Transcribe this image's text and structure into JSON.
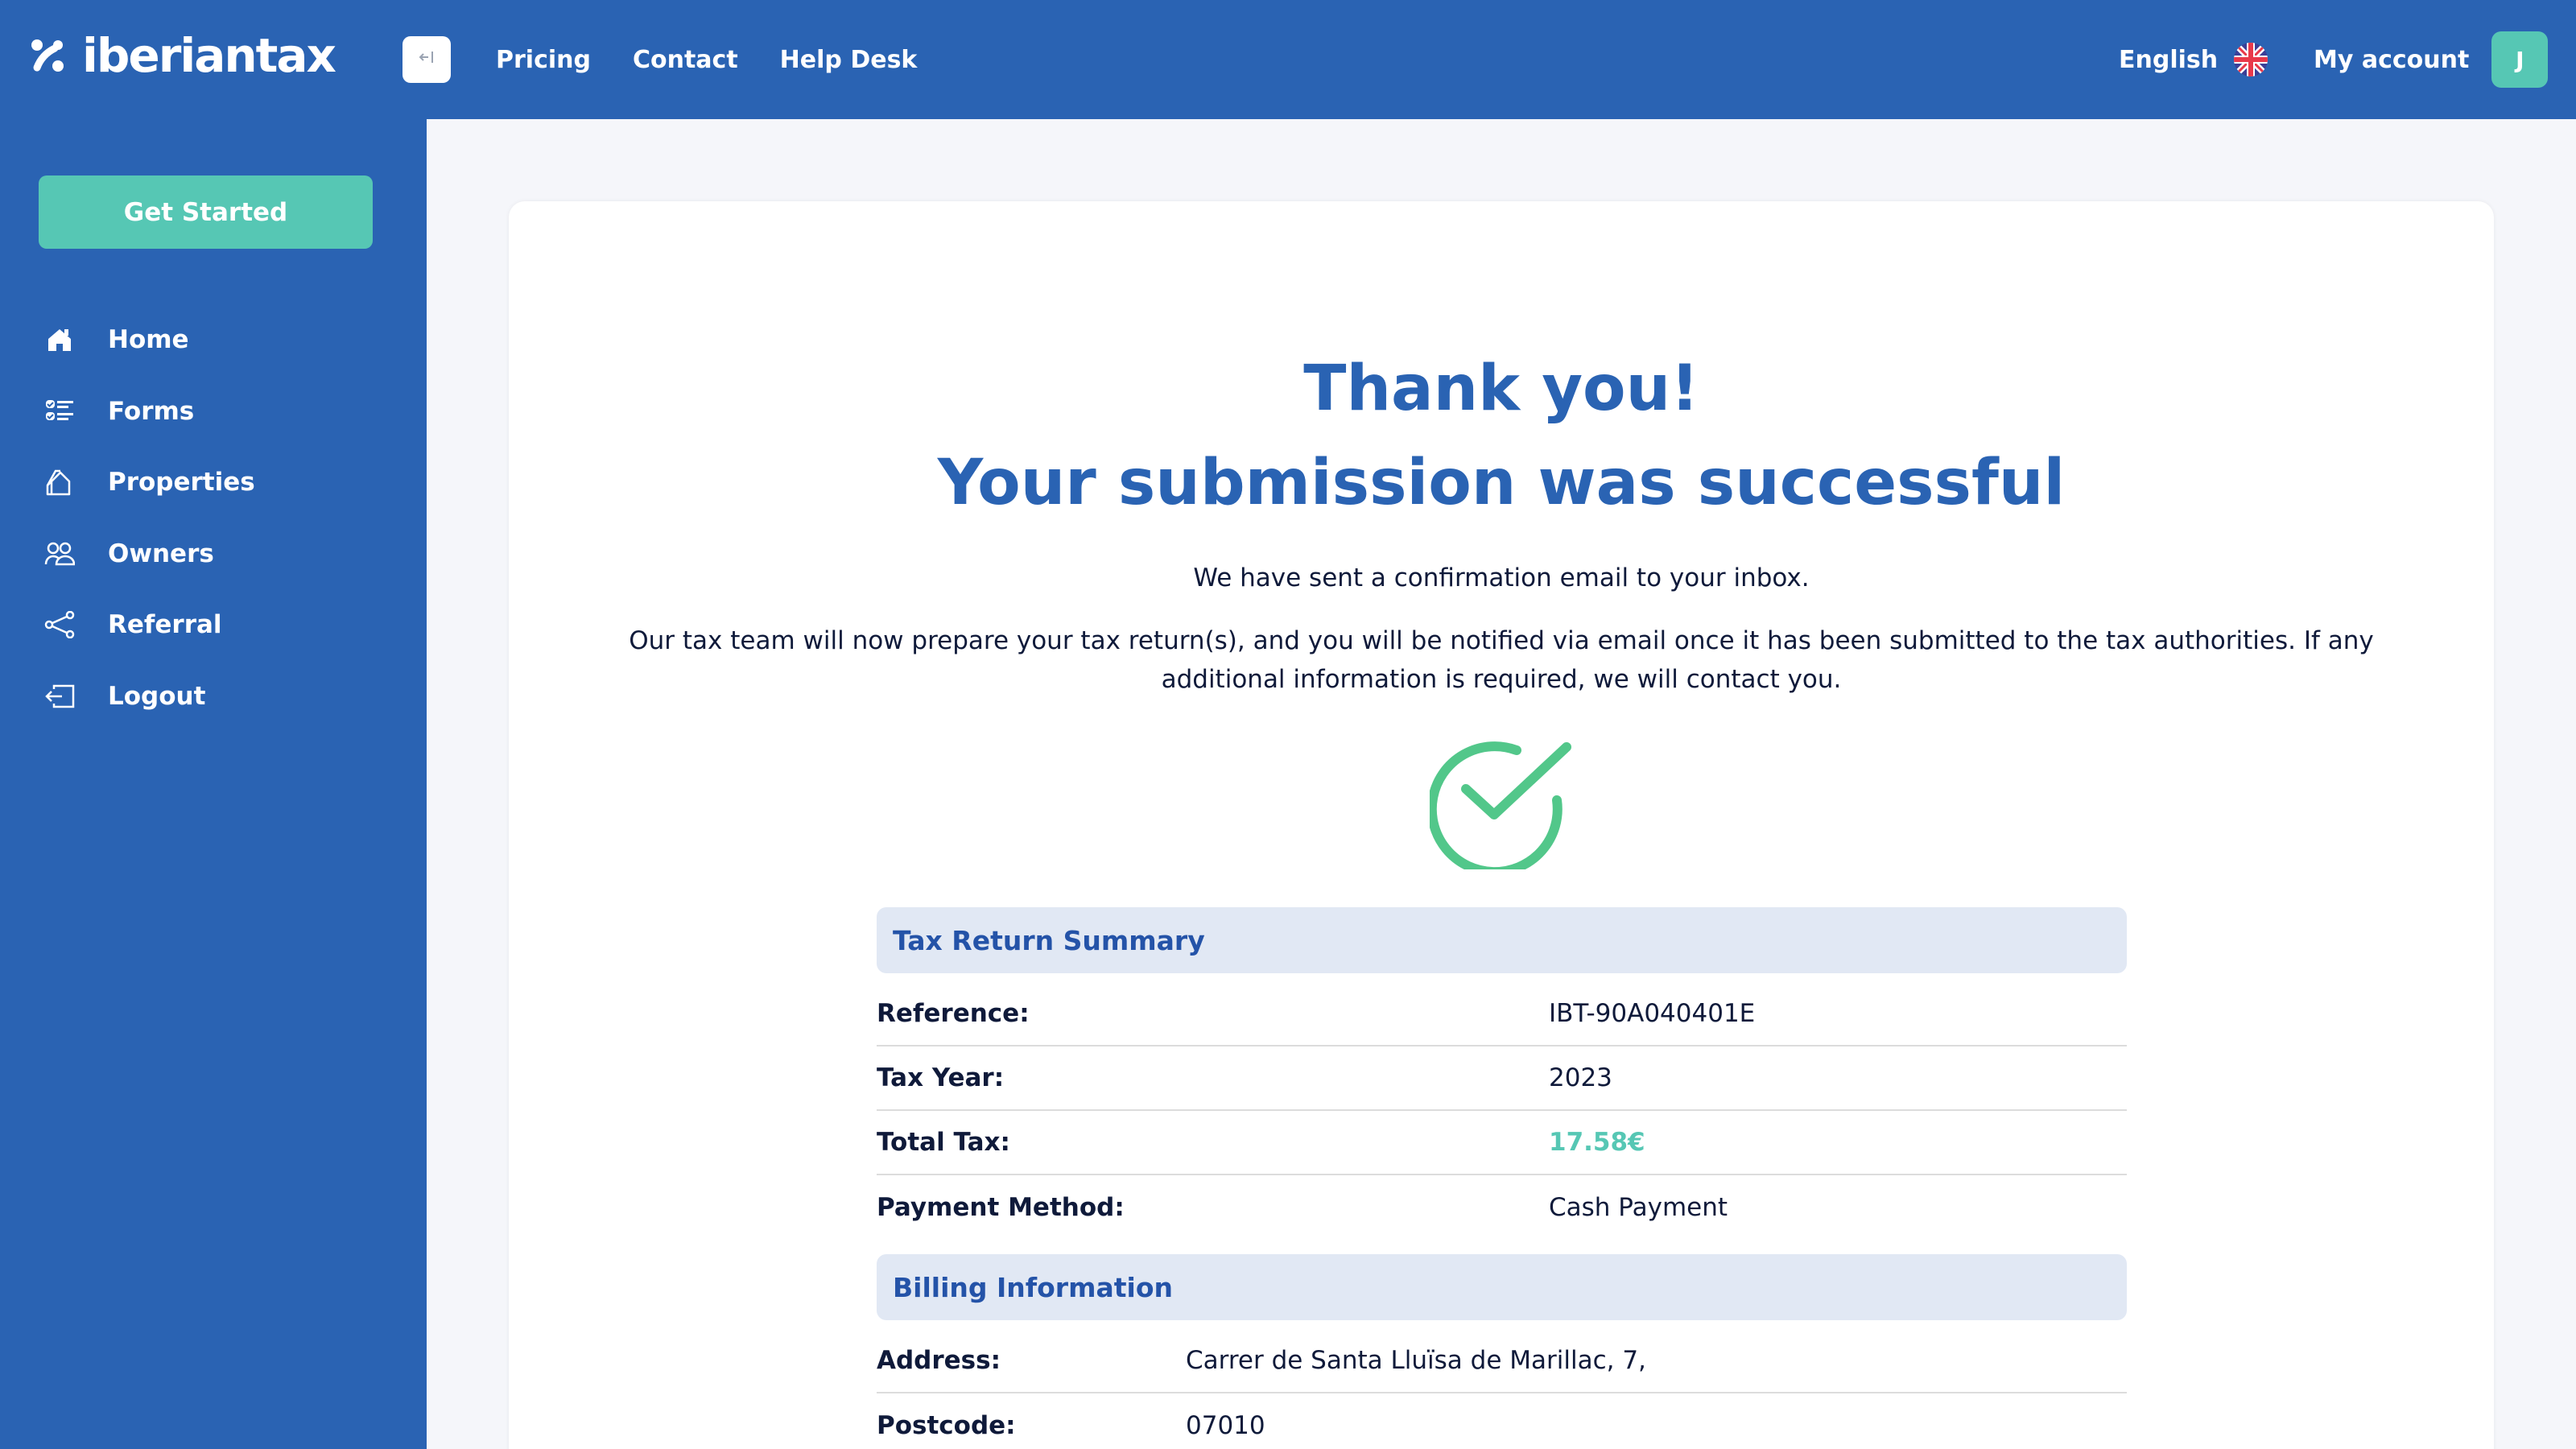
{
  "header": {
    "brand": "iberiantax",
    "nav": [
      "Pricing",
      "Contact",
      "Help Desk"
    ],
    "language": "English",
    "account_label": "My account",
    "avatar_initial": "J"
  },
  "sidebar": {
    "cta_label": "Get Started",
    "items": [
      {
        "label": "Home",
        "icon": "home-icon"
      },
      {
        "label": "Forms",
        "icon": "checklist-icon"
      },
      {
        "label": "Properties",
        "icon": "house-outline-icon"
      },
      {
        "label": "Owners",
        "icon": "users-icon"
      },
      {
        "label": "Referral",
        "icon": "share-icon"
      },
      {
        "label": "Logout",
        "icon": "logout-icon"
      }
    ]
  },
  "main": {
    "title_line1": "Thank you!",
    "title_line2": "Your submission was successful",
    "confirmation_text": "We have sent a confirmation email to your inbox.",
    "info_text": "Our tax team will now prepare your tax return(s), and you will be notified via email once it has been submitted to the tax authorities. If any additional information is required, we will contact you.",
    "summary": {
      "heading": "Tax Return Summary",
      "rows": [
        {
          "label": "Reference:",
          "value": "IBT-90A040401E"
        },
        {
          "label": "Tax Year:",
          "value": "2023"
        },
        {
          "label": "Total Tax:",
          "value": "17.58€"
        },
        {
          "label": "Payment Method:",
          "value": "Cash Payment"
        }
      ]
    },
    "billing": {
      "heading": "Billing Information",
      "rows": [
        {
          "label": "Address:",
          "value": "Carrer de Santa Lluïsa de Marillac, 7,"
        },
        {
          "label": "Postcode:",
          "value": "07010"
        }
      ]
    }
  },
  "colors": {
    "brand_blue": "#2a63b3",
    "accent_teal": "#56c7b4",
    "success_green": "#52c78a",
    "section_bg": "#e1e8f4"
  }
}
